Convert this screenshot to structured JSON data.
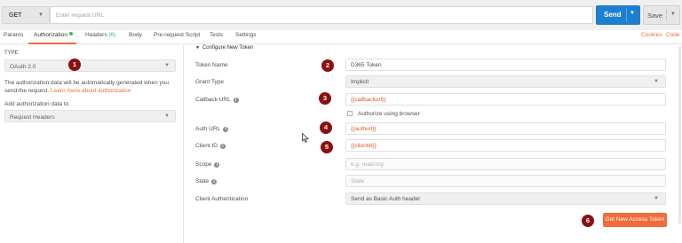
{
  "request": {
    "method": "GET",
    "url_placeholder": "Enter request URL",
    "send_label": "Send",
    "save_label": "Save"
  },
  "tabs": [
    {
      "label": "Params"
    },
    {
      "label": "Authorization"
    },
    {
      "label": "Headers"
    },
    {
      "label": "(6)"
    },
    {
      "label": "Body"
    },
    {
      "label": "Pre-request Script"
    },
    {
      "label": "Tests"
    },
    {
      "label": "Settings"
    }
  ],
  "tab_links": {
    "cookies": "Cookies",
    "code": "Code"
  },
  "auth": {
    "type_label": "TYPE",
    "type_value": "OAuth 2.0",
    "description": "The authorization data will be automatically generated when you send the request.",
    "learn_more": "Learn more about authorization",
    "add_to_label": "Add authorization data to",
    "add_to_value": "Request Headers"
  },
  "config": {
    "section_title": "Configure New Token",
    "fields": {
      "token_name": {
        "label": "Token Name",
        "value": "D365 Token"
      },
      "grant_type": {
        "label": "Grant Type",
        "value": "Implicit"
      },
      "callback_url": {
        "label": "Callback URL",
        "value": "{{callbackurl}}"
      },
      "authorize_browser": {
        "label": "Authorize using browser"
      },
      "auth_url": {
        "label": "Auth URL",
        "value": "{{authurl}}"
      },
      "client_id": {
        "label": "Client ID",
        "value": "{{clientid}}"
      },
      "scope": {
        "label": "Scope",
        "placeholder": "e.g. read:org"
      },
      "state": {
        "label": "State",
        "placeholder": "State"
      },
      "client_auth": {
        "label": "Client Authentication",
        "value": "Send as Basic Auth header"
      }
    },
    "get_token_label": "Get New Access Token"
  },
  "annotations": [
    "1",
    "2",
    "3",
    "4",
    "5",
    "6"
  ],
  "colors": {
    "accent": "#f26b3a",
    "send": "#1e7fd0",
    "badge": "#8b0f12",
    "status_ok": "#44b45a"
  }
}
